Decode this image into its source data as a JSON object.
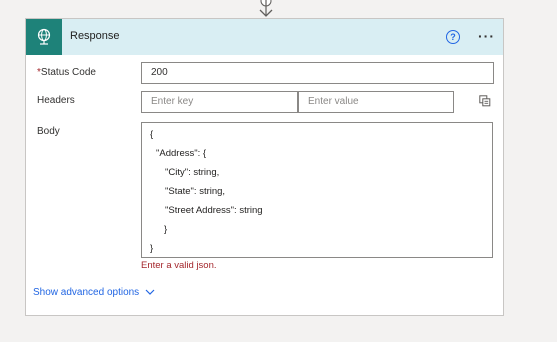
{
  "card": {
    "title": "Response",
    "help_label": "?",
    "more_label": "···"
  },
  "form": {
    "status_code": {
      "required_mark": "*",
      "label": "Status Code",
      "value": "200"
    },
    "headers": {
      "label": "Headers",
      "key_placeholder": "Enter key",
      "value_placeholder": "Enter value"
    },
    "body": {
      "label": "Body",
      "lines": [
        "{",
        "\"Address\": {",
        "\"City\": string,",
        "\"State\": string,",
        "\"Street Address\": string",
        "}",
        "}"
      ],
      "error": "Enter a valid json."
    }
  },
  "advanced": {
    "label": "Show advanced options"
  },
  "colors": {
    "header_bg": "#d9eef3",
    "icon_bg": "#1e8279",
    "link": "#2266e3",
    "error": "#a4262c"
  },
  "icons": [
    "arrow-down-icon",
    "globe-icon",
    "help-icon",
    "more-icon",
    "copy-icon",
    "chevron-down-icon"
  ]
}
